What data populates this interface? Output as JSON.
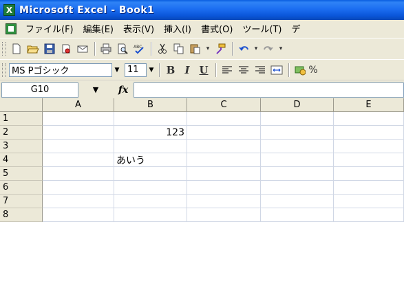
{
  "window": {
    "title": "Microsoft Excel - Book1",
    "app_icon": "excel-icon"
  },
  "menu": {
    "items": [
      {
        "label": "ファイル(F)",
        "name": "menu-file"
      },
      {
        "label": "編集(E)",
        "name": "menu-edit"
      },
      {
        "label": "表示(V)",
        "name": "menu-view"
      },
      {
        "label": "挿入(I)",
        "name": "menu-insert"
      },
      {
        "label": "書式(O)",
        "name": "menu-format"
      },
      {
        "label": "ツール(T)",
        "name": "menu-tools"
      },
      {
        "label": "デ",
        "name": "menu-data"
      }
    ]
  },
  "toolbar_standard": {
    "icons": [
      "new-icon",
      "open-icon",
      "save-icon",
      "permission-icon",
      "email-icon",
      "print-icon",
      "print-preview-icon",
      "spelling-icon",
      "cut-icon",
      "copy-icon",
      "paste-icon",
      "format-painter-icon",
      "undo-icon",
      "redo-icon"
    ]
  },
  "toolbar_format": {
    "font_name": "MS Pゴシック",
    "font_size": "11",
    "bold": "B",
    "italic": "I",
    "underline": "U"
  },
  "formula": {
    "name_box": "G10",
    "fx_label": "fx",
    "content": ""
  },
  "sheet": {
    "columns": [
      "A",
      "B",
      "C",
      "D",
      "E"
    ],
    "rows": [
      "1",
      "2",
      "3",
      "4",
      "5",
      "6",
      "7",
      "8"
    ],
    "cells": {
      "B2": "123",
      "B4": "あいう"
    }
  }
}
